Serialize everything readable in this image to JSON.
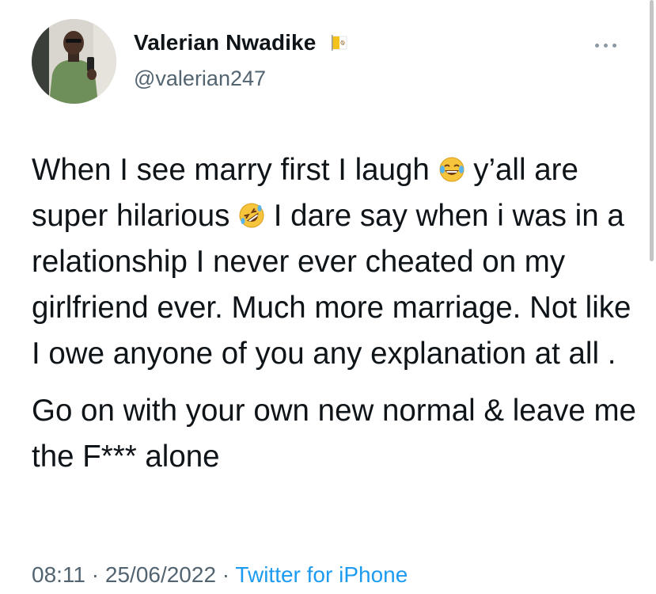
{
  "author": {
    "display_name": "Valerian Nwadike",
    "handle": "@valerian247",
    "name_badge_icon": "vatican-flag-icon"
  },
  "header": {
    "more_icon": "more-options-icon"
  },
  "tweet": {
    "paragraph1": {
      "part1": "When I see marry first I laugh ",
      "emoji1": "face-with-tears-of-joy-emoji",
      "part2": " y’all are super hilarious ",
      "emoji2": "rolling-on-the-floor-laughing-emoji",
      "part3": " I dare say when i was in a relationship I never ever cheated on my girlfriend ever. Much more marriage. Not like I owe anyone of you any explanation at all ."
    },
    "paragraph2": "Go on with your own new normal & leave me the F*** alone"
  },
  "meta": {
    "time": "08:11",
    "separator1": " · ",
    "date": "25/06/2022",
    "separator2": " · ",
    "source": "Twitter for iPhone"
  },
  "colors": {
    "text": "#0f1419",
    "secondary": "#536471",
    "link": "#1d9bf0",
    "background": "#ffffff"
  }
}
